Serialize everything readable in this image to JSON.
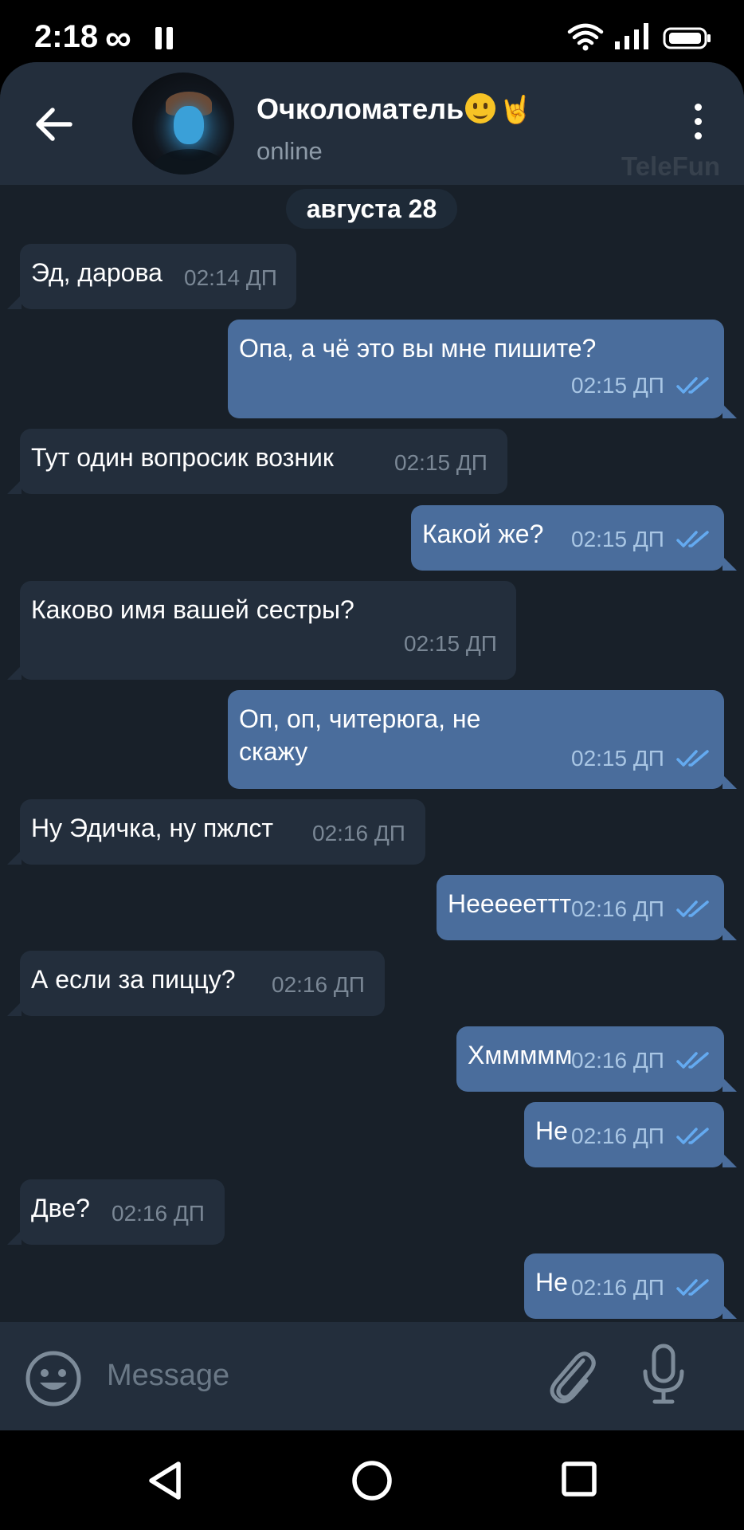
{
  "status_bar": {
    "time": "2:18",
    "infinity_symbol": "∞",
    "icons": [
      "pause-icon",
      "wifi-icon",
      "signal-icon",
      "battery-icon"
    ]
  },
  "header": {
    "back_icon": "arrow-left-icon",
    "chat_name": "Очколоматель",
    "chat_name_emoji_2": "🤘",
    "status": "online",
    "menu_icon": "more-vertical-icon",
    "watermark": "TeleFun"
  },
  "chat": {
    "date": "августа 28",
    "messages": [
      {
        "dir": "in",
        "text": "Эд, дарова",
        "time": "02:14 ДП"
      },
      {
        "dir": "out",
        "text": "Опа, а чё это вы мне пишите?",
        "time": "02:15 ДП"
      },
      {
        "dir": "in",
        "text": "Тут один вопросик возник",
        "time": "02:15 ДП"
      },
      {
        "dir": "out",
        "text": "Какой же?",
        "time": "02:15 ДП"
      },
      {
        "dir": "in",
        "text": "Каково имя вашей сестры?",
        "time": "02:15 ДП"
      },
      {
        "dir": "out",
        "text_lines": [
          "Оп, оп, читерюга, не",
          "скажу"
        ],
        "time": "02:15 ДП"
      },
      {
        "dir": "in",
        "text": "Ну Эдичка, ну пжлст",
        "time": "02:16 ДП"
      },
      {
        "dir": "out",
        "text": "Неееееттт",
        "time": "02:16 ДП"
      },
      {
        "dir": "in",
        "text": "А если за пиццу?",
        "time": "02:16 ДП"
      },
      {
        "dir": "out",
        "text": "Хммммм",
        "time": "02:16 ДП"
      },
      {
        "dir": "out",
        "text": "Не",
        "time": "02:16 ДП"
      },
      {
        "dir": "in",
        "text": "Две?",
        "time": "02:16 ДП"
      },
      {
        "dir": "out",
        "text": "Не",
        "time": "02:16 ДП"
      }
    ]
  },
  "composer": {
    "placeholder": "Message",
    "icons": [
      "emoji-icon",
      "paperclip-icon",
      "microphone-icon"
    ]
  },
  "nav_bar": {
    "icons": [
      "nav-back-icon",
      "nav-home-icon",
      "nav-recents-icon"
    ]
  },
  "colors": {
    "background": "#182029",
    "header": "#232e3c",
    "incoming_bubble": "#232e3c",
    "outgoing_bubble": "#4a6d9c",
    "read_checks": "#64aaf0"
  }
}
